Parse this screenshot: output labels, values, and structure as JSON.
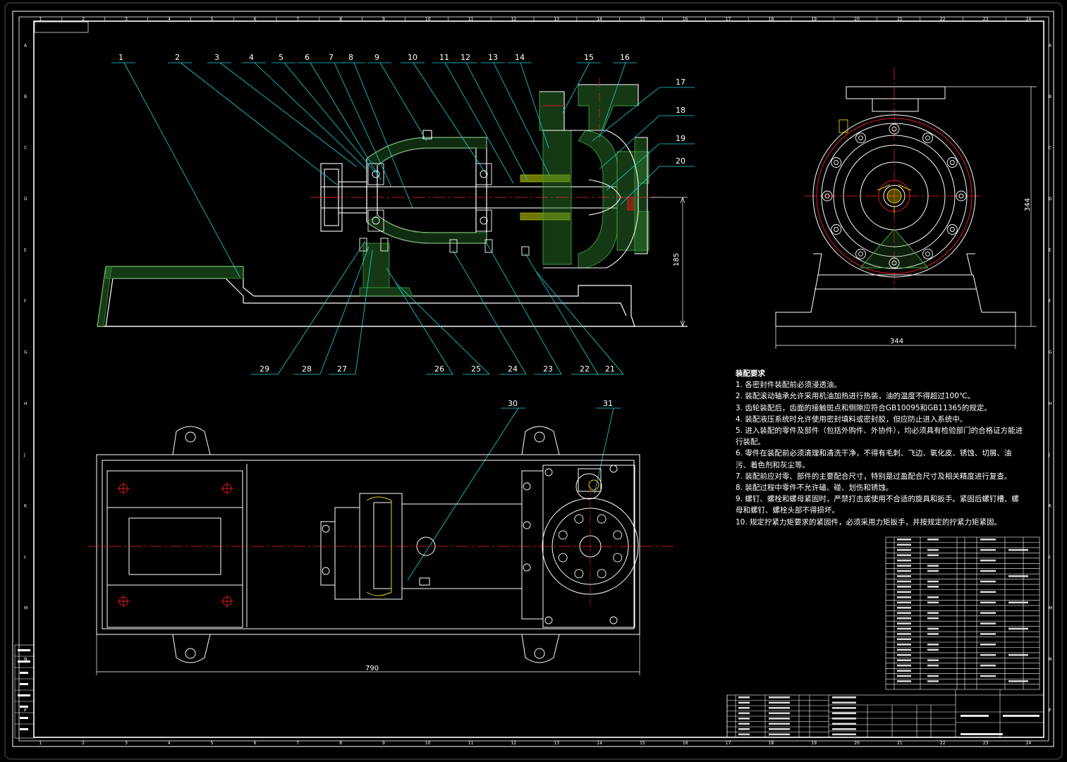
{
  "colors": {
    "background": "#000000",
    "outline": "#ffffff",
    "leader": "#19d7e0",
    "centerline": "#ff2020",
    "hatch": "#3fa23f",
    "red_detail": "#e01818",
    "yellow_detail": "#e8d200",
    "frame": "#ffffff"
  },
  "grid": {
    "top_numbers": [
      "1",
      "2",
      "3",
      "4",
      "5",
      "6",
      "7",
      "8",
      "9",
      "10",
      "11",
      "12",
      "13",
      "14",
      "15",
      "16",
      "17",
      "18",
      "19",
      "20",
      "21",
      "22",
      "23",
      "24"
    ],
    "side_letters": [
      "A",
      "B",
      "C",
      "D",
      "E",
      "F",
      "G",
      "H",
      "J",
      "K",
      "L",
      "M",
      "N",
      "P"
    ]
  },
  "balloons_top": [
    "1",
    "2",
    "3",
    "4",
    "5",
    "6",
    "7",
    "8",
    "9",
    "10",
    "11",
    "12",
    "13",
    "14",
    "15",
    "16"
  ],
  "balloons_right": [
    "17",
    "18",
    "19",
    "20"
  ],
  "balloons_bottom": [
    "29",
    "28",
    "27",
    "26",
    "25",
    "24",
    "23",
    "22",
    "21"
  ],
  "balloons_plan": [
    "30",
    "31"
  ],
  "dimensions": {
    "height_side": "185",
    "height_end": "344",
    "width_end": "344",
    "length_plan": "790"
  },
  "notes": {
    "title": "装配要求",
    "items": [
      "1. 各密封件装配前必须浸透油。",
      "2. 装配滚动轴承允许采用机油加热进行热装，油的温度不得超过100℃。",
      "3. 齿轮装配后，齿面的接触斑点和侧隙应符合GB10095和GB11365的规定。",
      "4. 装配液压系统时允许使用密封填料或密封胶，但应防止进入系统中。",
      "5. 进入装配的零件及部件（包括外购件、外协件），均必须具有检验部门的合格证方能进行装配。",
      "6. 零件在装配前必须清理和清洗干净，不得有毛刺、飞边、氧化皮、锈蚀、切屑、油污、着色剂和灰尘等。",
      "7. 装配前应对零、部件的主要配合尺寸，特别是过盈配合尺寸及相关精度进行复查。",
      "8. 装配过程中零件不允许磕、碰、划伤和锈蚀。",
      "9. 螺钉、螺栓和螺母紧固时，严禁打击或使用不合适的旋具和扳手。紧固后螺钉槽、螺母和螺钉、螺栓头部不得损坏。",
      "10. 规定拧紧力矩要求的紧固件，必须采用力矩扳手，并按规定的拧紧力矩紧固。"
    ]
  }
}
